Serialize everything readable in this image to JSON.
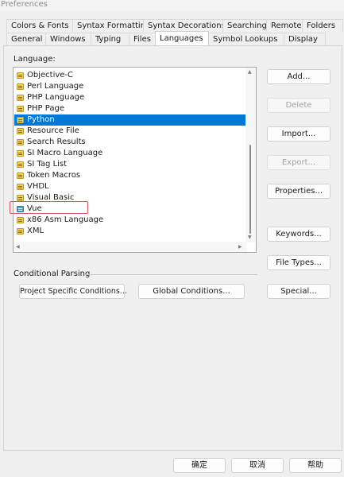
{
  "window": {
    "title": "Preferences"
  },
  "tabs": {
    "row1": [
      "Colors & Fonts",
      "Syntax Formatting",
      "Syntax Decorations",
      "Searching",
      "Remote",
      "Folders"
    ],
    "row2": [
      "General",
      "Windows",
      "Typing",
      "Files",
      "Languages",
      "Symbol Lookups",
      "Display"
    ],
    "active": "Languages"
  },
  "language": {
    "label": "Language:",
    "items": [
      "Objective-C",
      "Perl Language",
      "PHP Language",
      "PHP Page",
      "Python",
      "Resource File",
      "Search Results",
      "SI Macro Language",
      "SI Tag List",
      "Token Macros",
      "VHDL",
      "Visual Basic",
      "Vue",
      "x86 Asm Language",
      "XML"
    ],
    "selected": "Python",
    "highlighted": "Vue"
  },
  "buttons": {
    "add": "Add...",
    "delete": "Delete",
    "import": "Import...",
    "export": "Export...",
    "properties": "Properties...",
    "keywords": "Keywords...",
    "file_types": "File Types...",
    "special": "Special..."
  },
  "conditional": {
    "label": "Conditional Parsing",
    "project": "Project Specific Conditions...",
    "global": "Global Conditions..."
  },
  "dialog": {
    "ok": "确定",
    "cancel": "取消",
    "help": "帮助"
  },
  "colors": {
    "selection": "#0078d7",
    "highlight_border": "#e05260"
  }
}
